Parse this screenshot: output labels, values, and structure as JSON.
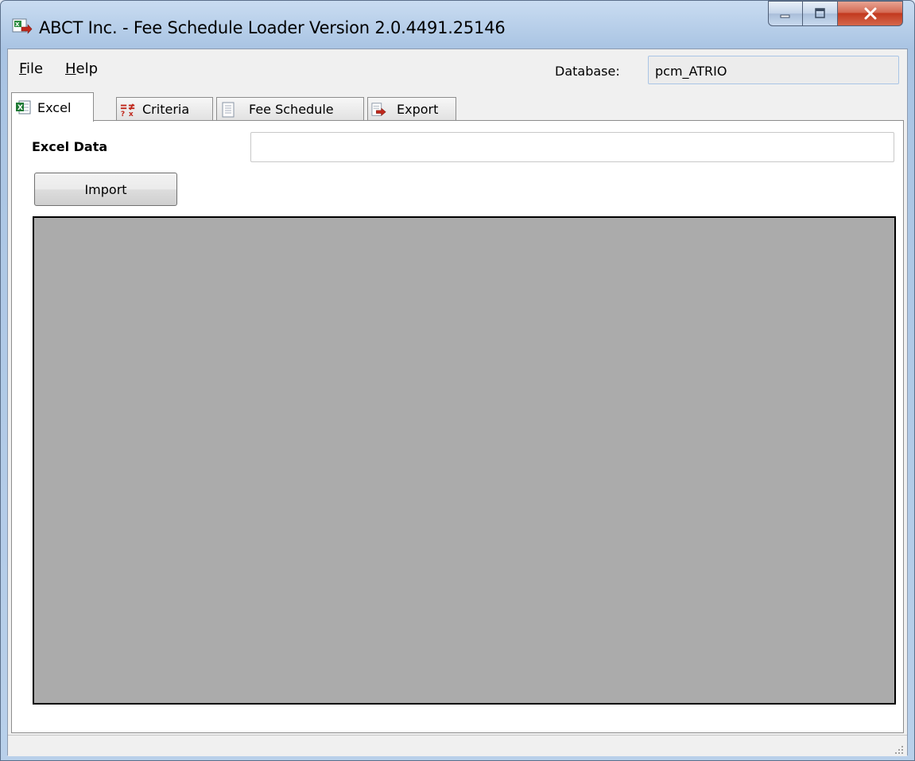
{
  "window": {
    "title": "ABCT Inc. - Fee Schedule Loader Version 2.0.4491.25146"
  },
  "menu": {
    "file": {
      "accel": "F",
      "rest": "ile"
    },
    "help": {
      "accel": "H",
      "rest": "elp"
    }
  },
  "database": {
    "label": "Database:",
    "value": "pcm_ATRIO"
  },
  "tabs": [
    {
      "label": "Excel",
      "icon": "excel-icon",
      "active": true
    },
    {
      "label": "Criteria",
      "icon": "criteria-icon",
      "active": false
    },
    {
      "label": "Fee Schedule",
      "icon": "document-icon",
      "active": false
    },
    {
      "label": "Export",
      "icon": "export-icon",
      "active": false
    }
  ],
  "excel": {
    "label": "Excel Data",
    "path_value": "",
    "import_label": "Import"
  },
  "colors": {
    "grid_background": "#ababab",
    "excel_icon": "#1f7a35",
    "criteria_icon": "#c0281c"
  }
}
